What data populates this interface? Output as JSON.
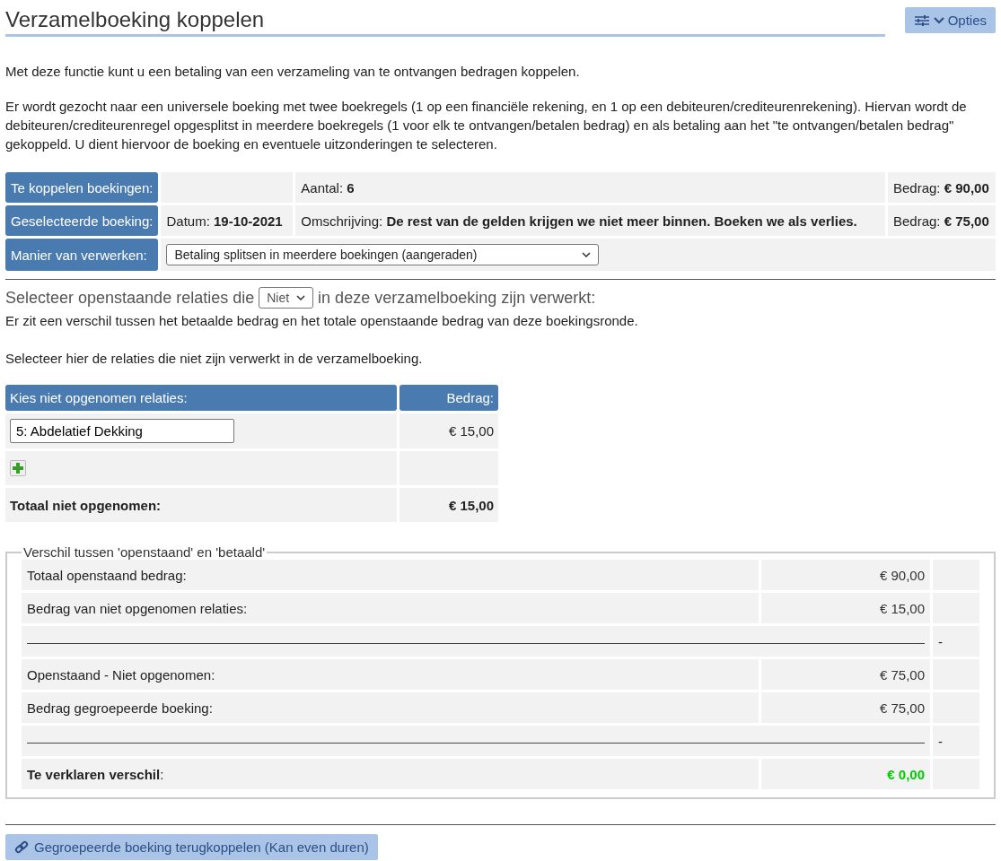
{
  "header": {
    "title": "Verzamelboeking koppelen",
    "options_button": "Opties"
  },
  "intro": [
    "Met deze functie kunt u een betaling van een verzameling van te ontvangen bedragen koppelen.",
    "Er wordt gezocht naar een universele boeking met twee boekregels (1 op een financiële rekening, en 1 op een debiteuren/crediteurenrekening). Hiervan wordt de debiteuren/crediteurenregel opgesplitst in meerdere boekregels (1 voor elk te ontvangen/betalen bedrag) en als betaling aan het \"te ontvangen/betalen bedrag\" gekoppeld. U dient hiervoor de boeking en eventuele uitzonderingen te selecteren."
  ],
  "info_table": [
    {
      "label": "Te koppelen boekingen:",
      "kind": "cells",
      "cells": [
        "",
        "Aantal: **6**",
        "Bedrag: **€ 90,00**"
      ]
    },
    {
      "label": "Geselecteerde boeking:",
      "kind": "cells",
      "cells": [
        "Datum: **19-10-2021**",
        "Omschrijving: **De rest van de gelden krijgen we niet meer binnen. Boeken we als verlies.**",
        "Bedrag: **€ 75,00**"
      ]
    },
    {
      "label": "Manier van verwerken:",
      "kind": "select",
      "value": "Betaling splitsen in meerdere boekingen (aangeraden)"
    }
  ],
  "selection": {
    "before": "Selecteer openstaande relaties die",
    "select_value": "Niet",
    "after": "in deze verzamelboeking zijn verwerkt:",
    "notes": [
      "Er zit een verschil tussen het betaalde bedrag en het totale openstaande bedrag van deze boekingsronde.",
      "Selecteer hier de relaties die niet zijn verwerkt in de verzamelboeking."
    ]
  },
  "relations_table": {
    "columns": [
      "Kies niet opgenomen relaties:",
      "Bedrag:"
    ],
    "rows": [
      {
        "relation": "5: Abdelatief Dekking",
        "amount": "€ 15,00"
      }
    ],
    "total_label": "Totaal niet opgenomen:",
    "total_amount": "€ 15,00"
  },
  "difference": {
    "legend": "Verschil tussen 'openstaand' en 'betaald'",
    "rows": [
      {
        "kind": "amount",
        "label": "Totaal openstaand bedrag:",
        "amount": "€ 90,00",
        "color": "#333333",
        "total": false
      },
      {
        "kind": "amount",
        "label": "Bedrag van niet opgenomen relaties:",
        "amount": "€ 15,00",
        "color": "#333333",
        "total": false
      },
      {
        "kind": "rule",
        "sign": "-"
      },
      {
        "kind": "amount",
        "label": "Openstaand - Niet opgenomen:",
        "amount": "€ 75,00",
        "color": "#333333",
        "total": false
      },
      {
        "kind": "amount",
        "label": "Bedrag gegroepeerde boeking:",
        "amount": "€ 75,00",
        "color": "#333333",
        "total": false
      },
      {
        "kind": "rule",
        "sign": "-"
      },
      {
        "kind": "amount",
        "label": "**Te verklaren verschil**:",
        "amount": "€ 0,00",
        "color": "#00cc00",
        "total": true
      }
    ]
  },
  "footer_button": "Gegroepeerde boeking terugkoppelen (Kan even duren)"
}
